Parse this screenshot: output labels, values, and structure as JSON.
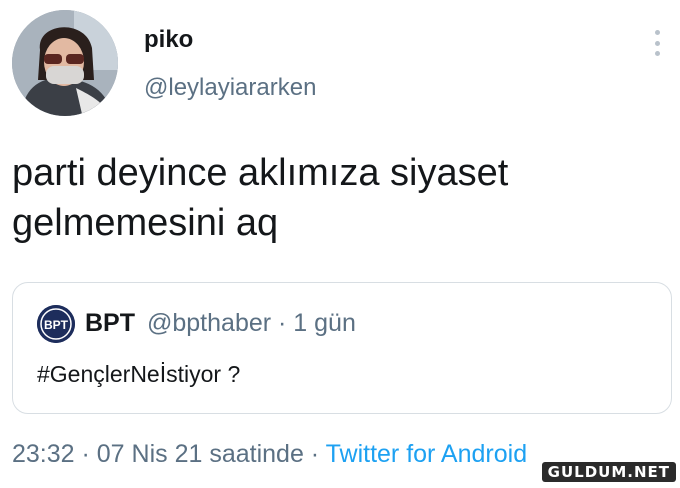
{
  "tweet": {
    "display_name": "piko",
    "handle": "@leylayiararken",
    "text": "parti deyince aklımıza siyaset gelmemesini aq",
    "timestamp": "23:32 · 07 Nis 21 saatinde · ",
    "source": "Twitter for Android",
    "more_icon": "more-vertical-icon"
  },
  "quoted_tweet": {
    "display_name": "BPT",
    "handle": "@bpthaber",
    "separator": " · ",
    "time_ago": "1 gün",
    "text": "#GençlerNeİstiyor ?",
    "avatar_label": "BPT"
  },
  "watermark": "GULDUM.NET",
  "colors": {
    "text": "#14171a",
    "secondary": "#5b7083",
    "link": "#1da1f2",
    "border": "#d8dee3"
  }
}
